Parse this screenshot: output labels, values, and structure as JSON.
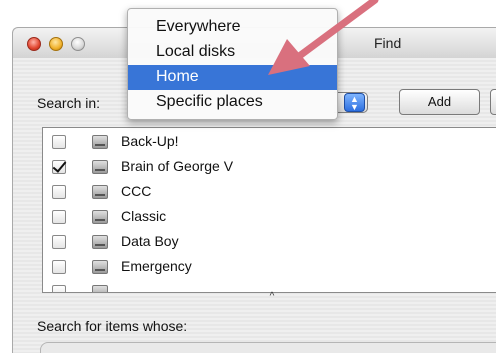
{
  "window": {
    "title": "Find"
  },
  "search_in": {
    "label": "Search in:",
    "add_label": "Add"
  },
  "menu": {
    "items": [
      {
        "label": "Everywhere",
        "selected": false
      },
      {
        "label": "Local disks",
        "selected": false
      },
      {
        "label": "Home",
        "selected": true
      },
      {
        "label": "Specific places",
        "selected": false
      }
    ]
  },
  "locations": {
    "items": [
      {
        "label": "Back-Up!",
        "checked": false
      },
      {
        "label": "Brain of George V",
        "checked": true
      },
      {
        "label": "CCC",
        "checked": false
      },
      {
        "label": "Classic",
        "checked": false
      },
      {
        "label": "Data Boy",
        "checked": false
      },
      {
        "label": "Emergency",
        "checked": false
      }
    ]
  },
  "criteria": {
    "label": "Search for items whose:"
  },
  "colors": {
    "selection": "#3875d7",
    "arrow": "#d9707e"
  },
  "icons": {
    "disk": "hard-disk-icon",
    "checkbox": "checkbox",
    "popup": "popup-arrows-icon",
    "scroll": "scroll-up-icon"
  }
}
